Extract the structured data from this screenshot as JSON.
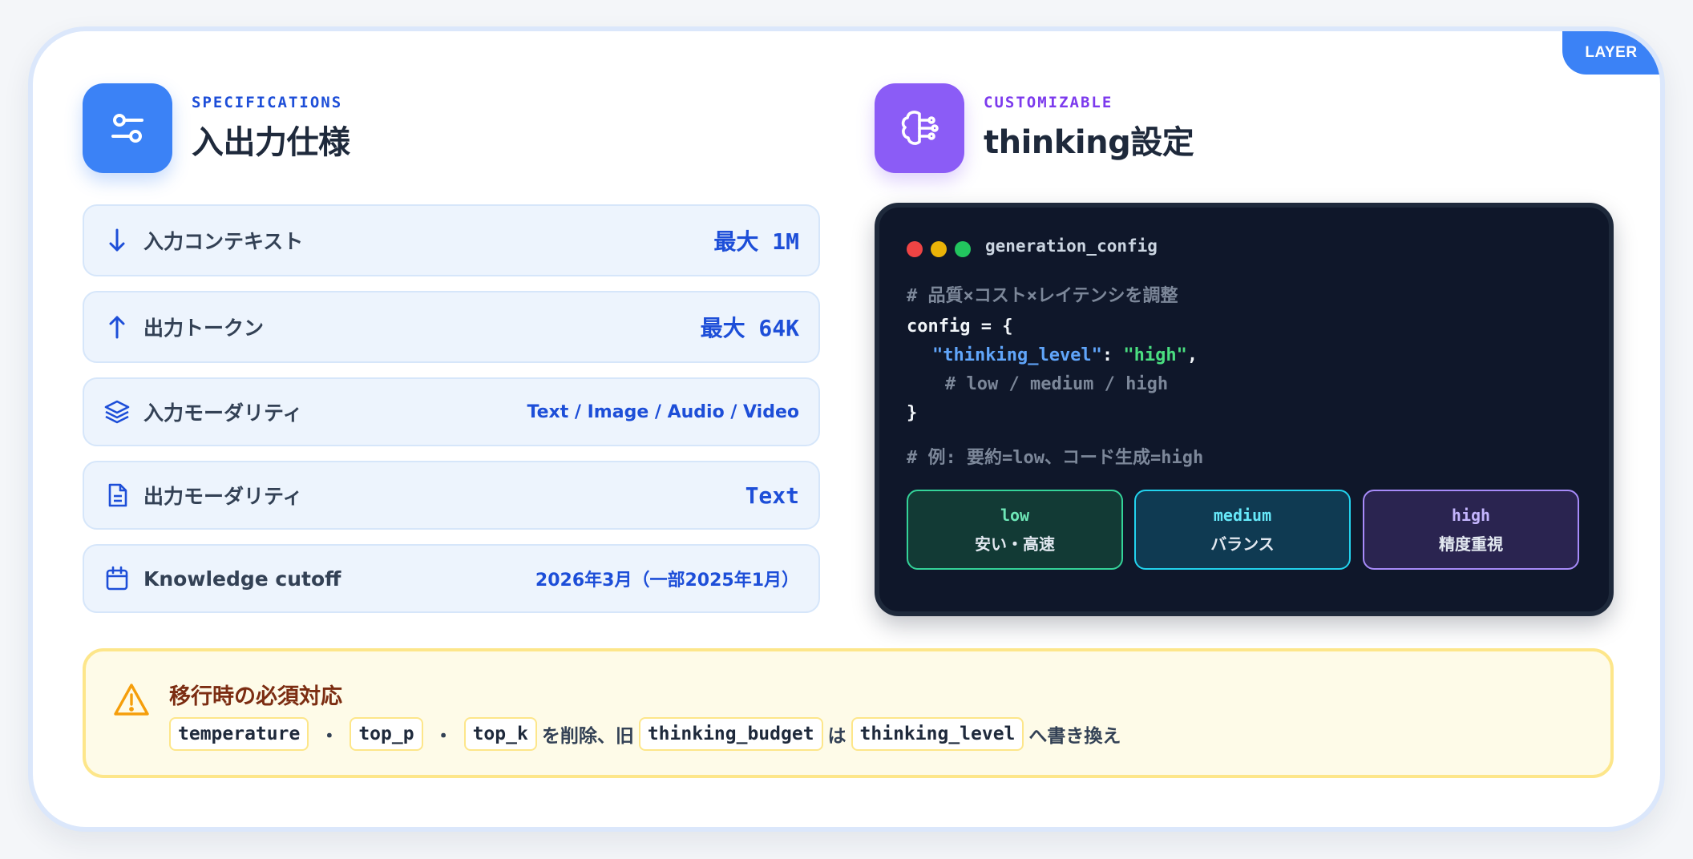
{
  "layer_tag": "LAYER",
  "left_section": {
    "eyebrow": "SPECIFICATIONS",
    "title": "入出力仕様",
    "rows": [
      {
        "icon": "arrow-down-icon",
        "label": "入力コンテキスト",
        "value": "最大 1M"
      },
      {
        "icon": "arrow-up-icon",
        "label": "出力トークン",
        "value": "最大 64K"
      },
      {
        "icon": "layers-icon",
        "label": "入力モーダリティ",
        "value": "Text / Image / Audio / Video"
      },
      {
        "icon": "document-icon",
        "label": "出力モーダリティ",
        "value": "Text"
      },
      {
        "icon": "calendar-icon",
        "label": "Knowledge cutoff",
        "value": "2026年3月（一部2025年1月）"
      }
    ]
  },
  "right_section": {
    "eyebrow": "CUSTOMIZABLE",
    "title": "thinking設定",
    "panel": {
      "title": "generation_config",
      "comment1": "# 品質×コスト×レイテンシを調整",
      "line_open": "config = {",
      "key": "\"thinking_level\"",
      "colon": ": ",
      "value": "\"high\"",
      "comma": ",",
      "comment_levels": "# low / medium / high",
      "line_close": "}",
      "comment_example": "# 例: 要約=low、コード生成=high",
      "levels": [
        {
          "name": "low",
          "desc": "安い・高速"
        },
        {
          "name": "medium",
          "desc": "バランス"
        },
        {
          "name": "high",
          "desc": "精度重視"
        }
      ]
    }
  },
  "warning": {
    "icon": "warning-icon",
    "title": "移行時の必須対応",
    "chip1": "temperature",
    "sep1": "・",
    "chip2": "top_p",
    "sep2": "・",
    "chip3": "top_k",
    "text1": "を削除、旧",
    "chip4": "thinking_budget",
    "text2": "は",
    "chip5": "thinking_level",
    "text3": "へ書き換え"
  },
  "colors": {
    "accent_blue": "#3b82f6",
    "accent_purple": "#8b5cf6",
    "warning_border": "#fde68a"
  }
}
